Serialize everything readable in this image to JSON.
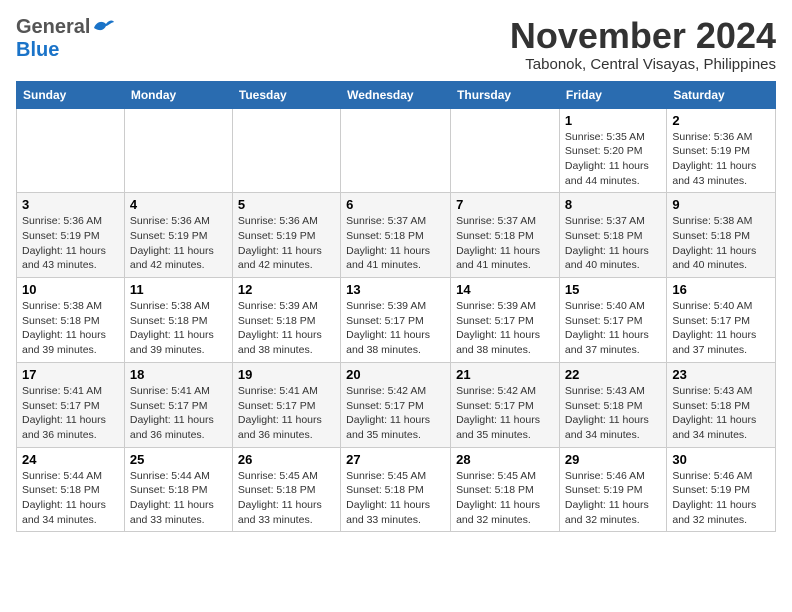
{
  "header": {
    "logo": {
      "general": "General",
      "blue": "Blue",
      "tagline": "General Blue"
    },
    "title": "November 2024",
    "location": "Tabonok, Central Visayas, Philippines"
  },
  "calendar": {
    "weekdays": [
      "Sunday",
      "Monday",
      "Tuesday",
      "Wednesday",
      "Thursday",
      "Friday",
      "Saturday"
    ],
    "weeks": [
      [
        {
          "day": "",
          "info": ""
        },
        {
          "day": "",
          "info": ""
        },
        {
          "day": "",
          "info": ""
        },
        {
          "day": "",
          "info": ""
        },
        {
          "day": "",
          "info": ""
        },
        {
          "day": "1",
          "info": "Sunrise: 5:35 AM\nSunset: 5:20 PM\nDaylight: 11 hours and 44 minutes."
        },
        {
          "day": "2",
          "info": "Sunrise: 5:36 AM\nSunset: 5:19 PM\nDaylight: 11 hours and 43 minutes."
        }
      ],
      [
        {
          "day": "3",
          "info": "Sunrise: 5:36 AM\nSunset: 5:19 PM\nDaylight: 11 hours and 43 minutes."
        },
        {
          "day": "4",
          "info": "Sunrise: 5:36 AM\nSunset: 5:19 PM\nDaylight: 11 hours and 42 minutes."
        },
        {
          "day": "5",
          "info": "Sunrise: 5:36 AM\nSunset: 5:19 PM\nDaylight: 11 hours and 42 minutes."
        },
        {
          "day": "6",
          "info": "Sunrise: 5:37 AM\nSunset: 5:18 PM\nDaylight: 11 hours and 41 minutes."
        },
        {
          "day": "7",
          "info": "Sunrise: 5:37 AM\nSunset: 5:18 PM\nDaylight: 11 hours and 41 minutes."
        },
        {
          "day": "8",
          "info": "Sunrise: 5:37 AM\nSunset: 5:18 PM\nDaylight: 11 hours and 40 minutes."
        },
        {
          "day": "9",
          "info": "Sunrise: 5:38 AM\nSunset: 5:18 PM\nDaylight: 11 hours and 40 minutes."
        }
      ],
      [
        {
          "day": "10",
          "info": "Sunrise: 5:38 AM\nSunset: 5:18 PM\nDaylight: 11 hours and 39 minutes."
        },
        {
          "day": "11",
          "info": "Sunrise: 5:38 AM\nSunset: 5:18 PM\nDaylight: 11 hours and 39 minutes."
        },
        {
          "day": "12",
          "info": "Sunrise: 5:39 AM\nSunset: 5:18 PM\nDaylight: 11 hours and 38 minutes."
        },
        {
          "day": "13",
          "info": "Sunrise: 5:39 AM\nSunset: 5:17 PM\nDaylight: 11 hours and 38 minutes."
        },
        {
          "day": "14",
          "info": "Sunrise: 5:39 AM\nSunset: 5:17 PM\nDaylight: 11 hours and 38 minutes."
        },
        {
          "day": "15",
          "info": "Sunrise: 5:40 AM\nSunset: 5:17 PM\nDaylight: 11 hours and 37 minutes."
        },
        {
          "day": "16",
          "info": "Sunrise: 5:40 AM\nSunset: 5:17 PM\nDaylight: 11 hours and 37 minutes."
        }
      ],
      [
        {
          "day": "17",
          "info": "Sunrise: 5:41 AM\nSunset: 5:17 PM\nDaylight: 11 hours and 36 minutes."
        },
        {
          "day": "18",
          "info": "Sunrise: 5:41 AM\nSunset: 5:17 PM\nDaylight: 11 hours and 36 minutes."
        },
        {
          "day": "19",
          "info": "Sunrise: 5:41 AM\nSunset: 5:17 PM\nDaylight: 11 hours and 36 minutes."
        },
        {
          "day": "20",
          "info": "Sunrise: 5:42 AM\nSunset: 5:17 PM\nDaylight: 11 hours and 35 minutes."
        },
        {
          "day": "21",
          "info": "Sunrise: 5:42 AM\nSunset: 5:17 PM\nDaylight: 11 hours and 35 minutes."
        },
        {
          "day": "22",
          "info": "Sunrise: 5:43 AM\nSunset: 5:18 PM\nDaylight: 11 hours and 34 minutes."
        },
        {
          "day": "23",
          "info": "Sunrise: 5:43 AM\nSunset: 5:18 PM\nDaylight: 11 hours and 34 minutes."
        }
      ],
      [
        {
          "day": "24",
          "info": "Sunrise: 5:44 AM\nSunset: 5:18 PM\nDaylight: 11 hours and 34 minutes."
        },
        {
          "day": "25",
          "info": "Sunrise: 5:44 AM\nSunset: 5:18 PM\nDaylight: 11 hours and 33 minutes."
        },
        {
          "day": "26",
          "info": "Sunrise: 5:45 AM\nSunset: 5:18 PM\nDaylight: 11 hours and 33 minutes."
        },
        {
          "day": "27",
          "info": "Sunrise: 5:45 AM\nSunset: 5:18 PM\nDaylight: 11 hours and 33 minutes."
        },
        {
          "day": "28",
          "info": "Sunrise: 5:45 AM\nSunset: 5:18 PM\nDaylight: 11 hours and 32 minutes."
        },
        {
          "day": "29",
          "info": "Sunrise: 5:46 AM\nSunset: 5:19 PM\nDaylight: 11 hours and 32 minutes."
        },
        {
          "day": "30",
          "info": "Sunrise: 5:46 AM\nSunset: 5:19 PM\nDaylight: 11 hours and 32 minutes."
        }
      ]
    ]
  }
}
